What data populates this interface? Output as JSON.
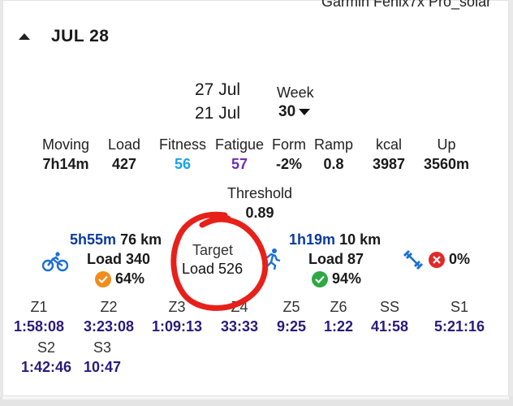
{
  "device": "Garmin Fenix7x Pro_solar",
  "header": {
    "date": "JUL 28"
  },
  "range": {
    "end": "27 Jul",
    "start": "21 Jul"
  },
  "week": {
    "label": "Week",
    "value": "30"
  },
  "stats": [
    {
      "label": "Moving",
      "value": "7h14m",
      "color": "#1a1a1a"
    },
    {
      "label": "Load",
      "value": "427",
      "color": "#1a1a1a"
    },
    {
      "label": "Fitness",
      "value": "56",
      "color": "#1aa3e8"
    },
    {
      "label": "Fatigue",
      "value": "57",
      "color": "#6b2fb3"
    },
    {
      "label": "Form",
      "value": "-2%",
      "color": "#1a1a1a"
    },
    {
      "label": "Ramp",
      "value": "0.8",
      "color": "#1a1a1a"
    },
    {
      "label": "kcal",
      "value": "3987",
      "color": "#1a1a1a"
    },
    {
      "label": "Up",
      "value": "3560m",
      "color": "#1a1a1a"
    }
  ],
  "threshold": {
    "label": "Threshold",
    "value": "0.89"
  },
  "bike": {
    "icon": "bike-icon",
    "time": "5h55m",
    "distance": "76 km",
    "load": "Load 340",
    "percent": "64%",
    "badge_color": "#f28c1c"
  },
  "target": {
    "label": "Target",
    "load": "Load 526"
  },
  "run": {
    "icon": "run-icon",
    "time": "1h19m",
    "distance": "10 km",
    "load": "Load 87",
    "percent": "94%",
    "badge_color": "#2fa844"
  },
  "strength": {
    "icon": "dumbbell-icon",
    "percent": "0%",
    "badge_color": "#e02a2a"
  },
  "zones": [
    {
      "label": "Z1",
      "value": "1:58:08"
    },
    {
      "label": "Z2",
      "value": "3:23:08"
    },
    {
      "label": "Z3",
      "value": "1:09:13"
    },
    {
      "label": "Z4",
      "value": "33:33"
    },
    {
      "label": "Z5",
      "value": "9:25"
    },
    {
      "label": "Z6",
      "value": "1:22"
    },
    {
      "label": "SS",
      "value": "41:58"
    },
    {
      "label": "S1",
      "value": "5:21:16"
    },
    {
      "label": "S2",
      "value": "1:42:46"
    },
    {
      "label": "S3",
      "value": "10:47"
    }
  ],
  "colors": {
    "accent_blue": "#1a6fd6",
    "annotation": "#e8201a",
    "zone_value": "#2b1a7a"
  }
}
